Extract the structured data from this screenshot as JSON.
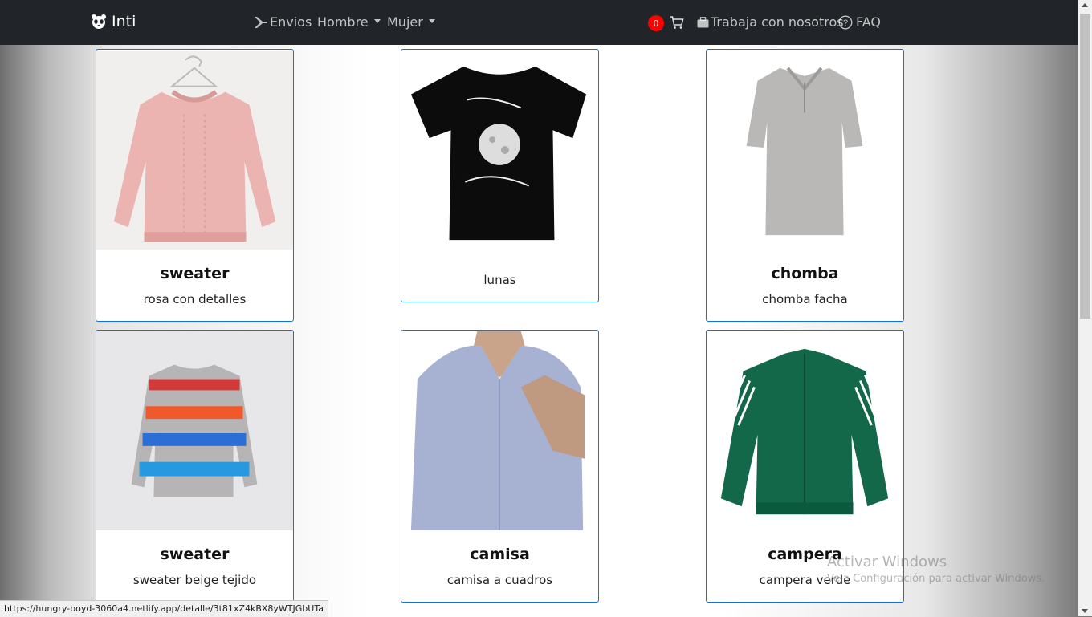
{
  "navbar": {
    "brand": "Inti",
    "items": [
      {
        "label": "Envios",
        "icon": "airplane-icon"
      },
      {
        "label": "Hombre",
        "dropdown": true
      },
      {
        "label": "Mujer",
        "dropdown": true
      }
    ],
    "cart_count": "0",
    "work_label": "Trabaja con nosotros",
    "faq_label": "FAQ"
  },
  "products": [
    {
      "title": "sweater",
      "description": "rosa con detalles",
      "image": "pink-sweater"
    },
    {
      "title": "",
      "description": "lunas",
      "image": "black-tshirt-moon"
    },
    {
      "title": "chomba",
      "description": "chomba facha",
      "image": "grey-polo"
    },
    {
      "title": "sweater",
      "description": "sweater beige tejido",
      "image": "striped-sweater"
    },
    {
      "title": "camisa",
      "description": "camisa a cuadros",
      "image": "blue-shirt-man"
    },
    {
      "title": "campera",
      "description": "campera verde",
      "image": "green-track-jacket"
    }
  ],
  "status_bar": {
    "url": "https://hungry-boyd-3060a4.netlify.app/detalle/3t81xZ4kBX8yWTJGbUTa"
  },
  "watermark": {
    "line1": "Activar Windows",
    "line2": "Ve a Configuración para activar Windows."
  },
  "colors": {
    "navbar": "#212529",
    "card_border": "#0d6efd",
    "badge": "#ff0000"
  }
}
